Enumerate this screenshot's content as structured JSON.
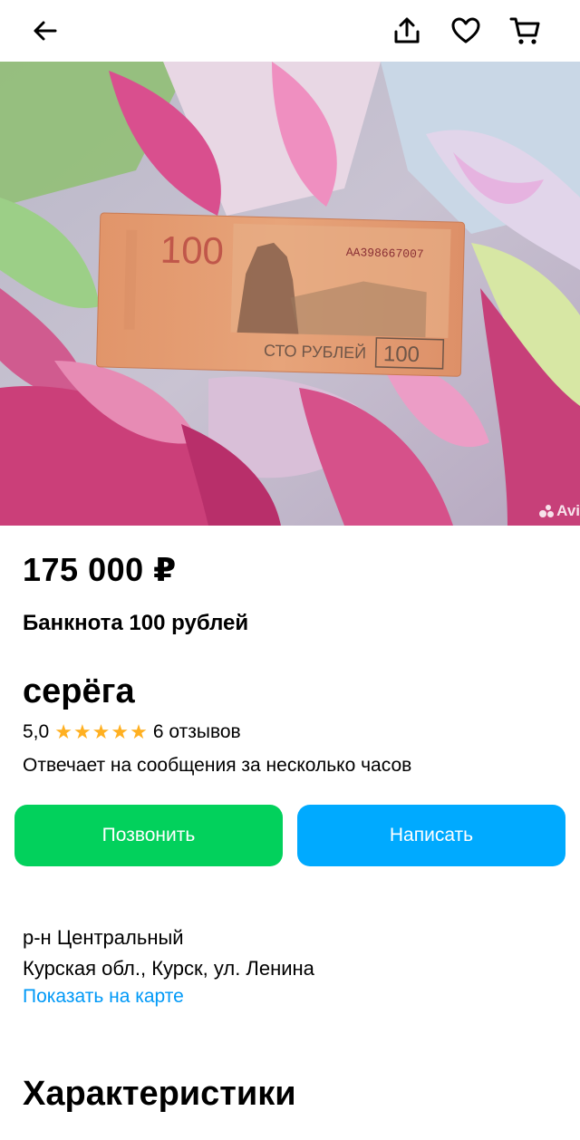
{
  "header": {
    "back_icon": "arrow-left-icon",
    "share_icon": "share-icon",
    "favorite_icon": "heart-icon",
    "cart_icon": "cart-icon"
  },
  "photo": {
    "watermark": "Avi",
    "banknote_denomination": "100",
    "banknote_serial": "АА398667007",
    "banknote_text": "СТО РУБЛЕЙ"
  },
  "listing": {
    "price": "175 000 ₽",
    "title": "Банкнота 100 рублей"
  },
  "seller": {
    "name": "серёга",
    "rating": "5,0",
    "stars": 5,
    "reviews": "6 отзывов",
    "response_time": "Отвечает на сообщения за несколько часов"
  },
  "actions": {
    "call_label": "Позвонить",
    "message_label": "Написать"
  },
  "location": {
    "district": "р-н Центральный",
    "address": "Курская обл., Курск, ул. Ленина",
    "map_link": "Показать на карте"
  },
  "sections": {
    "characteristics": "Характеристики"
  },
  "colors": {
    "call": "#02d15c",
    "message": "#00aaff",
    "link": "#0099f7",
    "star": "#ffb021"
  }
}
